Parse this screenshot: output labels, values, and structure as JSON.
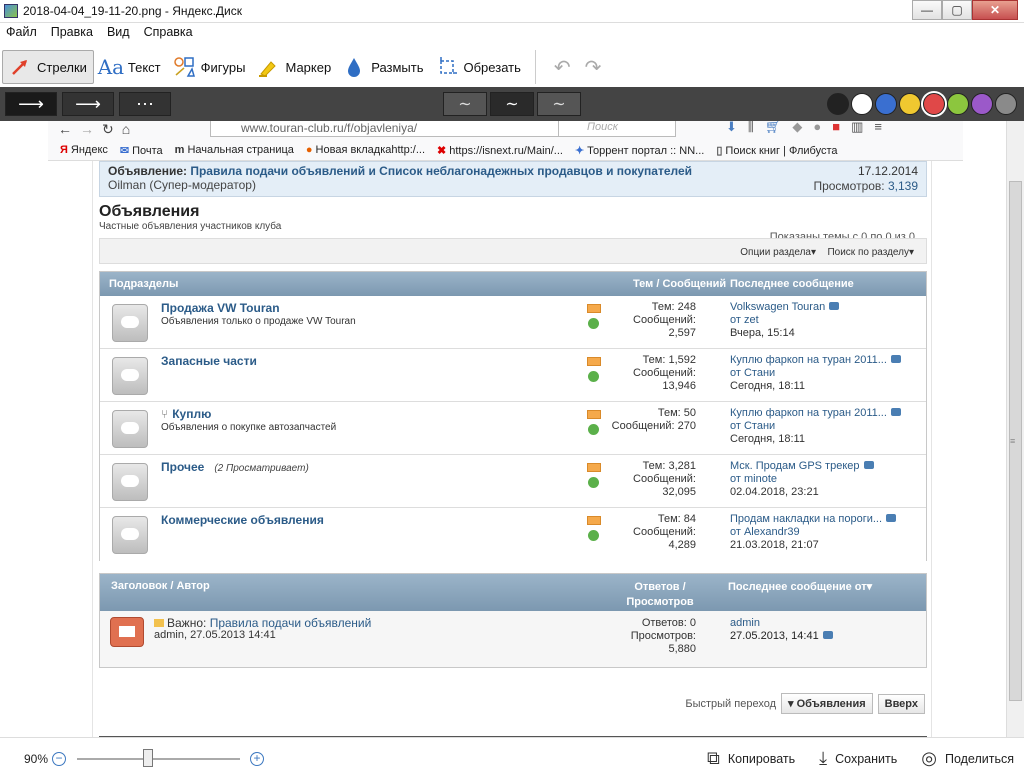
{
  "window": {
    "title": "2018-04-04_19-11-20.png - Яндекс.Диск",
    "min": "—",
    "max": "▢",
    "close": "✕"
  },
  "menu": [
    "Файл",
    "Правка",
    "Вид",
    "Справка"
  ],
  "toolbar": {
    "arrows": "Стрелки",
    "text": "Текст",
    "shapes": "Фигуры",
    "marker": "Маркер",
    "blur": "Размыть",
    "crop": "Обрезать",
    "undo": "↶",
    "redo": "↷"
  },
  "options": {
    "arrow_styles": [
      "⟶",
      "⟶",
      "⋯"
    ],
    "strokes": [
      "∼",
      "∼",
      "∼"
    ],
    "colors": [
      "#222222",
      "#ffffff",
      "#3a6fd0",
      "#f0c830",
      "#e04848",
      "#8cc63e",
      "#9b59c9",
      "#8a8a8a"
    ]
  },
  "browser": {
    "url": "www.touran-club.ru/f/objavleniya/",
    "search_placeholder": "Поиск",
    "bookmarks": [
      "Яндекс",
      "Почта",
      "Начальная страница",
      "Новая вкладкаhttp:/...",
      "https://isnext.ru/Main/...",
      "Торрент портал :: NN...",
      "Поиск книг | Флибуста"
    ]
  },
  "announcement": {
    "label": "Объявление:",
    "title": "Правила подачи объявлений и Список неблагонадежных продавцов и покупателей",
    "date": "17.12.2014",
    "author": "Oilman (Супер-модератор)",
    "views_label": "Просмотров:",
    "views": "3,139"
  },
  "section": {
    "title": "Объявления",
    "subtitle": "Частные объявления участников клуба",
    "shown": "Показаны темы с 0 по 0 из 0",
    "options": "Опции раздела▾",
    "search": "Поиск по разделу▾"
  },
  "forums": {
    "head": {
      "name": "Подразделы",
      "stats": "Тем / Сообщений",
      "last": "Последнее сообщение"
    },
    "rows": [
      {
        "name": "Продажа VW Touran",
        "desc": "Объявления только о продаже VW Touran",
        "viewers": "",
        "s1": "Тем: 248",
        "s2": "Сообщений:",
        "s3": "2,597",
        "lt": "Volkswagen Touran",
        "lu": "от zet",
        "ld": "Вчера, 15:14"
      },
      {
        "name": "Запасные части",
        "desc": "",
        "viewers": "",
        "s1": "Тем: 1,592",
        "s2": "Сообщений:",
        "s3": "13,946",
        "lt": "Куплю фаркоп на туран 2011...",
        "lu": "от Стани",
        "ld": "Сегодня, 18:11"
      },
      {
        "name": "Куплю",
        "desc": "Объявления о покупке автозапчастей",
        "viewers": "",
        "s1": "Тем: 50",
        "s2": "Сообщений: 270",
        "s3": "",
        "lt": "Куплю фаркоп на туран 2011...",
        "lu": "от Стани",
        "ld": "Сегодня, 18:11"
      },
      {
        "name": "Прочее",
        "desc": "",
        "viewers": "(2 Просматривает)",
        "s1": "Тем: 3,281",
        "s2": "Сообщений:",
        "s3": "32,095",
        "lt": "Мск. Продам GPS трекер",
        "lu": "от minote",
        "ld": "02.04.2018, 23:21"
      },
      {
        "name": "Коммерческие объявления",
        "desc": "",
        "viewers": "",
        "s1": "Тем: 84",
        "s2": "Сообщений:",
        "s3": "4,289",
        "lt": "Продам накладки на пороги...",
        "lu": "от Alexandr39",
        "ld": "21.03.2018, 21:07"
      }
    ]
  },
  "threads": {
    "head": {
      "title": "Заголовок / Автор",
      "stats": "Ответов / Просмотров",
      "last": "Последнее сообщение от▾"
    },
    "rows": [
      {
        "prefix": "Важно:",
        "title": "Правила подачи объявлений",
        "author": "admin, 27.05.2013 14:41",
        "s1": "Ответов: 0",
        "s2": "Просмотров:",
        "s3": "5,880",
        "lu": "admin",
        "ld": "27.05.2013, 14:41"
      }
    ]
  },
  "jump": {
    "label": "Быстрый переход",
    "target": "▾ Объявления",
    "top": "Вверх"
  },
  "status": {
    "zoom": "90%",
    "copy": "Копировать",
    "save": "Сохранить",
    "share": "Поделиться"
  }
}
